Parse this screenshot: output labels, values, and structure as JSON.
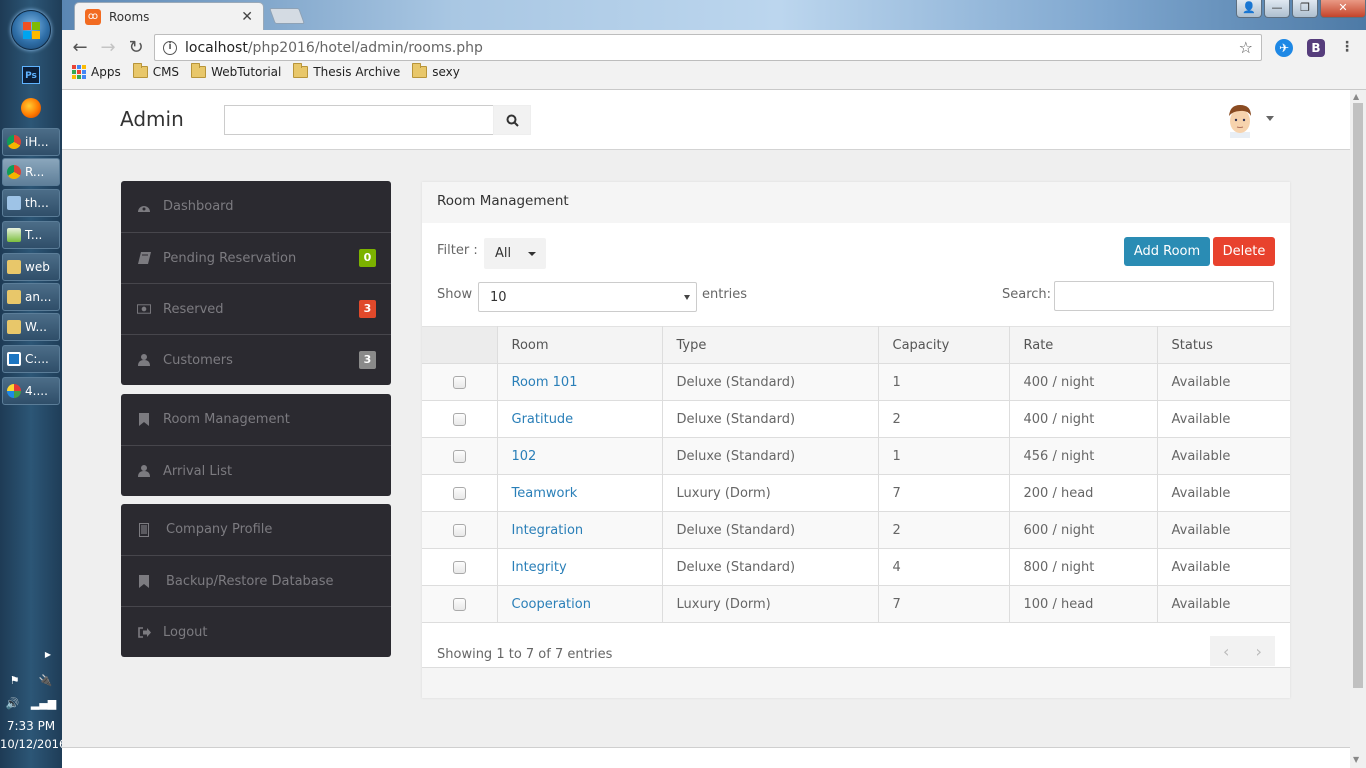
{
  "taskbar": {
    "pinned": [
      {
        "name": "photoshop",
        "label": "Ps"
      },
      {
        "name": "firefox",
        "label": ""
      }
    ],
    "tasks": [
      {
        "label": "iH...",
        "icon": "chrome",
        "active": false
      },
      {
        "label": "R...",
        "icon": "chrome",
        "active": true
      },
      {
        "label": "th...",
        "icon": "notepad",
        "active": false
      },
      {
        "label": "T...",
        "icon": "app",
        "active": false
      },
      {
        "label": "web",
        "icon": "folder",
        "active": false
      },
      {
        "label": "an...",
        "icon": "folder",
        "active": false
      },
      {
        "label": "W...",
        "icon": "folder",
        "active": false
      },
      {
        "label": "C:...",
        "icon": "brackets",
        "active": false
      },
      {
        "label": "4....",
        "icon": "paint",
        "active": false
      }
    ],
    "clock": {
      "time": "7:33 PM",
      "date": "10/12/2016"
    }
  },
  "browser": {
    "tab_title": "Rooms",
    "url_host": "localhost",
    "url_path": "/php2016/hotel/admin/rooms.php",
    "bookmarks": [
      {
        "label": "Apps",
        "icon": "apps-grid"
      },
      {
        "label": "CMS",
        "icon": "folder"
      },
      {
        "label": "WebTutorial",
        "icon": "folder"
      },
      {
        "label": "Thesis Archive",
        "icon": "folder"
      },
      {
        "label": "sexy",
        "icon": "folder"
      }
    ],
    "extensions": [
      {
        "name": "messenger",
        "label": "✈",
        "color": "#1e88e5"
      },
      {
        "name": "bootstrap",
        "label": "B",
        "color": "#563d7c"
      }
    ]
  },
  "header": {
    "brand": "Admin",
    "search_placeholder": ""
  },
  "sidebar": {
    "groups": [
      {
        "items": [
          {
            "label": "Dashboard",
            "icon": "dashboard",
            "badge": null
          },
          {
            "label": "Pending Reservation",
            "icon": "book",
            "badge": "0",
            "badge_color": "#7cb200"
          },
          {
            "label": "Reserved",
            "icon": "money",
            "badge": "3",
            "badge_color": "#e0492b"
          },
          {
            "label": "Customers",
            "icon": "user",
            "badge": "3",
            "badge_color": "#8a8a8a"
          }
        ]
      },
      {
        "items": [
          {
            "label": "Room Management",
            "icon": "bookmark",
            "badge": null
          },
          {
            "label": "Arrival List",
            "icon": "user",
            "badge": null
          }
        ]
      },
      {
        "items": [
          {
            "label": "Company Profile",
            "icon": "building",
            "badge": null
          },
          {
            "label": "Backup/Restore Database",
            "icon": "bookmark",
            "badge": null
          },
          {
            "label": "Logout",
            "icon": "sign-out",
            "badge": null
          }
        ]
      }
    ]
  },
  "main": {
    "title": "Room Management",
    "filter_label": "Filter :",
    "filter_value": "All",
    "add_button": "Add Room",
    "delete_button": "Delete",
    "show_label": "Show",
    "show_value": "10",
    "entries_label": "entries",
    "search_label": "Search:",
    "search_value": "",
    "columns": [
      "",
      "Room",
      "Type",
      "Capacity",
      "Rate",
      "Status"
    ],
    "rows": [
      {
        "room": "Room 101",
        "type": "Deluxe (Standard)",
        "capacity": "1",
        "rate": "400 / night",
        "status": "Available"
      },
      {
        "room": "Gratitude",
        "type": "Deluxe (Standard)",
        "capacity": "2",
        "rate": "400 / night",
        "status": "Available"
      },
      {
        "room": "102",
        "type": "Deluxe (Standard)",
        "capacity": "1",
        "rate": "456 / night",
        "status": "Available"
      },
      {
        "room": "Teamwork",
        "type": "Luxury (Dorm)",
        "capacity": "7",
        "rate": "200 / head",
        "status": "Available"
      },
      {
        "room": "Integration",
        "type": "Deluxe (Standard)",
        "capacity": "2",
        "rate": "600 / night",
        "status": "Available"
      },
      {
        "room": "Integrity",
        "type": "Deluxe (Standard)",
        "capacity": "4",
        "rate": "800 / night",
        "status": "Available"
      },
      {
        "room": "Cooperation",
        "type": "Luxury (Dorm)",
        "capacity": "7",
        "rate": "100 / head",
        "status": "Available"
      }
    ],
    "info": "Showing 1 to 7 of 7 entries",
    "pager_prev": "‹",
    "pager_next": "›"
  }
}
